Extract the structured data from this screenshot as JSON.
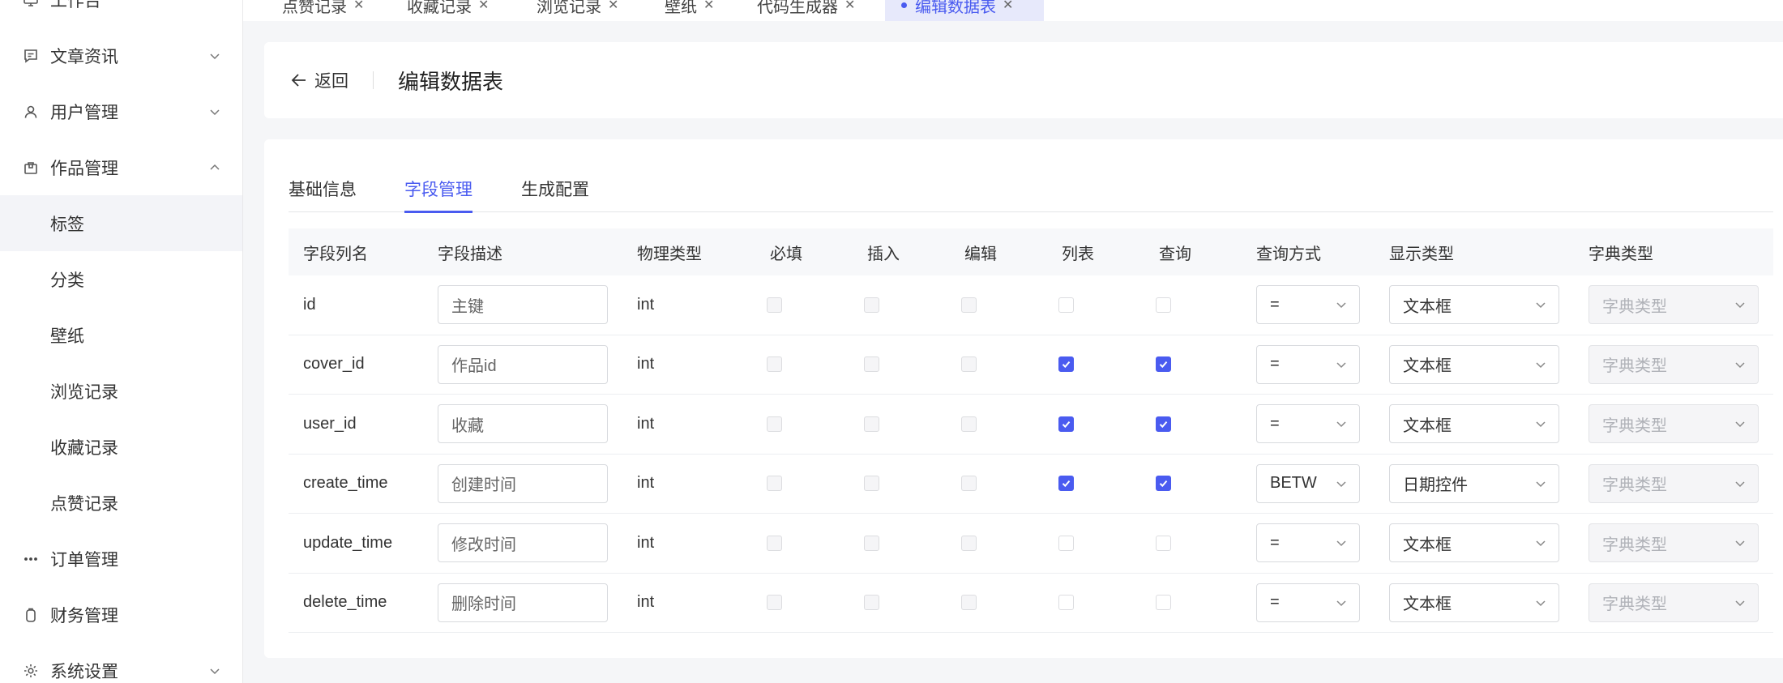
{
  "sidebar": {
    "items": [
      {
        "label": "工作台",
        "icon": "monitor-icon",
        "arrow": ""
      },
      {
        "label": "文章资讯",
        "icon": "message-square-icon",
        "arrow": "down"
      },
      {
        "label": "用户管理",
        "icon": "user-icon",
        "arrow": "down"
      },
      {
        "label": "作品管理",
        "icon": "package-icon",
        "arrow": "up"
      },
      {
        "label": "标签",
        "sub": true,
        "active": true
      },
      {
        "label": "分类",
        "sub": true
      },
      {
        "label": "壁纸",
        "sub": true
      },
      {
        "label": "浏览记录",
        "sub": true
      },
      {
        "label": "收藏记录",
        "sub": true
      },
      {
        "label": "点赞记录",
        "sub": true
      },
      {
        "label": "订单管理",
        "icon": "more-dots-icon",
        "arrow": ""
      },
      {
        "label": "财务管理",
        "icon": "clipboard-icon",
        "arrow": ""
      },
      {
        "label": "系统设置",
        "icon": "gear-icon",
        "arrow": "down"
      }
    ]
  },
  "top_tabs": [
    {
      "label": "点赞记录",
      "active": false
    },
    {
      "label": "收藏记录",
      "active": false
    },
    {
      "label": "浏览记录",
      "active": false
    },
    {
      "label": "壁纸",
      "active": false
    },
    {
      "label": "代码生成器",
      "active": false
    },
    {
      "label": "编辑数据表",
      "active": true
    }
  ],
  "header": {
    "back_label": "返回",
    "title": "编辑数据表"
  },
  "inner_tabs": [
    {
      "label": "基础信息",
      "active": false
    },
    {
      "label": "字段管理",
      "active": true
    },
    {
      "label": "生成配置",
      "active": false
    }
  ],
  "table": {
    "columns": [
      "字段列名",
      "字段描述",
      "物理类型",
      "必填",
      "插入",
      "编辑",
      "列表",
      "查询",
      "查询方式",
      "显示类型",
      "字典类型"
    ],
    "rows": [
      {
        "name": "id",
        "desc": "主键",
        "type": "int",
        "required": false,
        "insert": false,
        "edit": false,
        "list": false,
        "query": false,
        "query_mode": "=",
        "display": "文本框",
        "dict": "字典类型"
      },
      {
        "name": "cover_id",
        "desc": "作品id",
        "type": "int",
        "required": false,
        "insert": false,
        "edit": false,
        "list": true,
        "query": true,
        "query_mode": "=",
        "display": "文本框",
        "dict": "字典类型"
      },
      {
        "name": "user_id",
        "desc": "收藏",
        "type": "int",
        "required": false,
        "insert": false,
        "edit": false,
        "list": true,
        "query": true,
        "query_mode": "=",
        "display": "文本框",
        "dict": "字典类型"
      },
      {
        "name": "create_time",
        "desc": "创建时间",
        "type": "int",
        "required": false,
        "insert": false,
        "edit": false,
        "list": true,
        "query": true,
        "query_mode": "BETW",
        "display": "日期控件",
        "dict": "字典类型"
      },
      {
        "name": "update_time",
        "desc": "修改时间",
        "type": "int",
        "required": false,
        "insert": false,
        "edit": false,
        "list": false,
        "query": false,
        "query_mode": "=",
        "display": "文本框",
        "dict": "字典类型"
      },
      {
        "name": "delete_time",
        "desc": "删除时间",
        "type": "int",
        "required": false,
        "insert": false,
        "edit": false,
        "list": false,
        "query": false,
        "query_mode": "=",
        "display": "文本框",
        "dict": "字典类型"
      }
    ]
  },
  "colors": {
    "accent": "#4a5bf0",
    "active_tab_bg": "#e7e9fb"
  }
}
